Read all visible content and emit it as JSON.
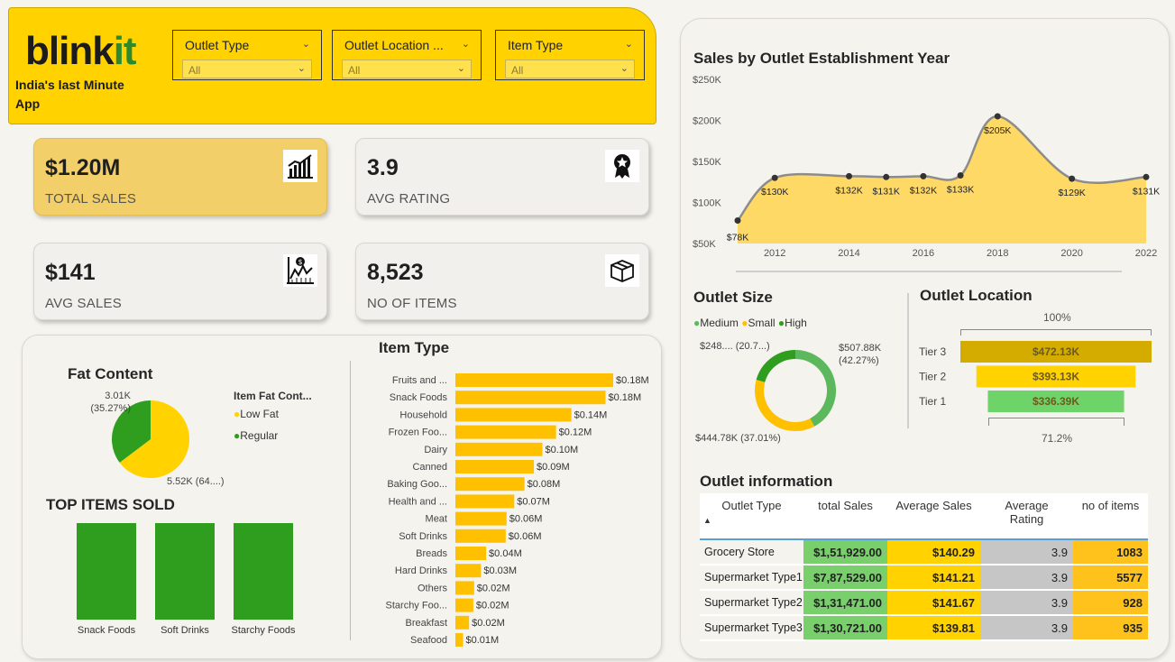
{
  "brand": {
    "logo_main": "blink",
    "logo_accent": "it",
    "tagline": "India's last Minute App"
  },
  "filters": [
    {
      "label": "Outlet Type",
      "value": "All"
    },
    {
      "label": "Outlet Location ...",
      "value": "All"
    },
    {
      "label": "Item Type",
      "value": "All"
    }
  ],
  "kpis": {
    "total_sales": {
      "value": "$1.20M",
      "caption": "TOTAL SALES",
      "icon": "growth-chart-icon"
    },
    "avg_rating": {
      "value": "3.9",
      "caption": "AVG RATING",
      "icon": "award-badge-icon"
    },
    "avg_sales": {
      "value": "$141",
      "caption": "AVG SALES",
      "icon": "dollar-chart-icon"
    },
    "no_of_items": {
      "value": "8,523",
      "caption": "NO OF ITEMS",
      "icon": "box-icon"
    }
  },
  "colors": {
    "accent": "#ffd200",
    "green": "#2f9e1f",
    "bar": "#ffc000",
    "area": "#ffd966"
  },
  "fat_content": {
    "title": "Fat Content",
    "legend_title": "Item Fat Cont...",
    "labels": {
      "regular": "3.01K (35.27%)",
      "low_fat": "5.52K (64....)"
    }
  },
  "top_items": {
    "title": "TOP ITEMS SOLD"
  },
  "item_type": {
    "title": "Item Type"
  },
  "sales_year": {
    "title": "Sales by Outlet Establishment Year"
  },
  "outlet_size": {
    "title": "Outlet Size",
    "labels": {
      "high": "$248.... (20.7...)",
      "small": "$507.88K (42.27%)",
      "medium": "$444.78K (37.01%)"
    }
  },
  "outlet_location": {
    "title": "Outlet Location",
    "top_pct": "100%",
    "bottom_pct": "71.2%"
  },
  "outlet_info": {
    "title": "Outlet information",
    "sort_icon": "▲",
    "columns": [
      "Outlet Type",
      "total Sales",
      "Average Sales",
      "Average Rating",
      "no of items"
    ],
    "rows": [
      {
        "type": "Grocery Store",
        "sales": "$1,51,929.00",
        "avg_sales": "$140.29",
        "rating": "3.9",
        "items": "1083"
      },
      {
        "type": "Supermarket Type1",
        "sales": "$7,87,529.00",
        "avg_sales": "$141.21",
        "rating": "3.9",
        "items": "5577"
      },
      {
        "type": "Supermarket Type2",
        "sales": "$1,31,471.00",
        "avg_sales": "$141.67",
        "rating": "3.9",
        "items": "928"
      },
      {
        "type": "Supermarket Type3",
        "sales": "$1,30,721.00",
        "avg_sales": "$139.81",
        "rating": "3.9",
        "items": "935"
      }
    ]
  },
  "chart_data": [
    {
      "type": "pie",
      "title": "Fat Content",
      "legend_title": "Item Fat Cont...",
      "categories": [
        "Low Fat",
        "Regular"
      ],
      "values": [
        5520,
        3010
      ],
      "colors": [
        "#ffd200",
        "#2f9e1f"
      ],
      "legend_position": "right"
    },
    {
      "type": "bar",
      "title": "TOP ITEMS SOLD",
      "categories": [
        "Snack Foods",
        "Soft Drinks",
        "Starchy Foods"
      ],
      "values": [
        1,
        1,
        1
      ],
      "color": "#2f9e1f"
    },
    {
      "type": "bar",
      "orientation": "horizontal",
      "title": "Item Type",
      "categories": [
        "Fruits and ...",
        "Snack Foods",
        "Household",
        "Frozen Foo...",
        "Dairy",
        "Canned",
        "Baking Goo...",
        "Health and ...",
        "Meat",
        "Soft Drinks",
        "Breads",
        "Hard Drinks",
        "Others",
        "Starchy Foo...",
        "Breakfast",
        "Seafood"
      ],
      "values": [
        0.18,
        0.18,
        0.14,
        0.12,
        0.1,
        0.09,
        0.08,
        0.07,
        0.06,
        0.06,
        0.04,
        0.03,
        0.02,
        0.02,
        0.02,
        0.01
      ],
      "value_labels": [
        "$0.18M",
        "$0.18M",
        "$0.14M",
        "$0.12M",
        "$0.10M",
        "$0.09M",
        "$0.08M",
        "$0.07M",
        "$0.06M",
        "$0.06M",
        "$0.04M",
        "$0.03M",
        "$0.02M",
        "$0.02M",
        "$0.02M",
        "$0.01M"
      ],
      "exact_values": [
        0.185,
        0.176,
        0.136,
        0.118,
        0.102,
        0.092,
        0.081,
        0.069,
        0.06,
        0.059,
        0.036,
        0.03,
        0.022,
        0.021,
        0.016,
        0.009
      ],
      "color": "#ffc000"
    },
    {
      "type": "area",
      "title": "Sales by Outlet Establishment Year",
      "x": [
        2011,
        2012,
        2014,
        2015,
        2016,
        2017,
        2018,
        2020,
        2022
      ],
      "values": [
        78,
        130,
        132,
        131,
        132,
        133,
        205,
        129,
        131
      ],
      "value_labels": [
        "$78K",
        "$130K",
        "$132K",
        "$131K",
        "$132K",
        "$133K",
        "$205K",
        "$129K",
        "$131K"
      ],
      "x_ticks": [
        "2012",
        "2014",
        "2016",
        "2018",
        "2020",
        "2022"
      ],
      "y_ticks": [
        "$50K",
        "$100K",
        "$150K",
        "$200K",
        "$250K"
      ],
      "ylim": [
        50,
        250
      ],
      "xlim": [
        2011,
        2022
      ],
      "color": "#ffd966",
      "line_color": "#8c8c8c"
    },
    {
      "type": "pie",
      "subtype": "donut",
      "title": "Outlet Size",
      "categories": [
        "Medium",
        "Small",
        "High"
      ],
      "values": [
        507.88,
        444.78,
        248.99
      ],
      "colors": [
        "#5cb85c",
        "#ffc000",
        "#2f9e1f"
      ],
      "legend_position": "top"
    },
    {
      "type": "bar",
      "subtype": "funnel",
      "title": "Outlet Location",
      "categories": [
        "Tier 3",
        "Tier 2",
        "Tier 1"
      ],
      "values": [
        472.13,
        393.13,
        336.39
      ],
      "value_labels": [
        "$472.13K",
        "$393.13K",
        "$336.39K"
      ],
      "colors": [
        "#d4ac00",
        "#ffd200",
        "#6ed46a"
      ]
    }
  ]
}
